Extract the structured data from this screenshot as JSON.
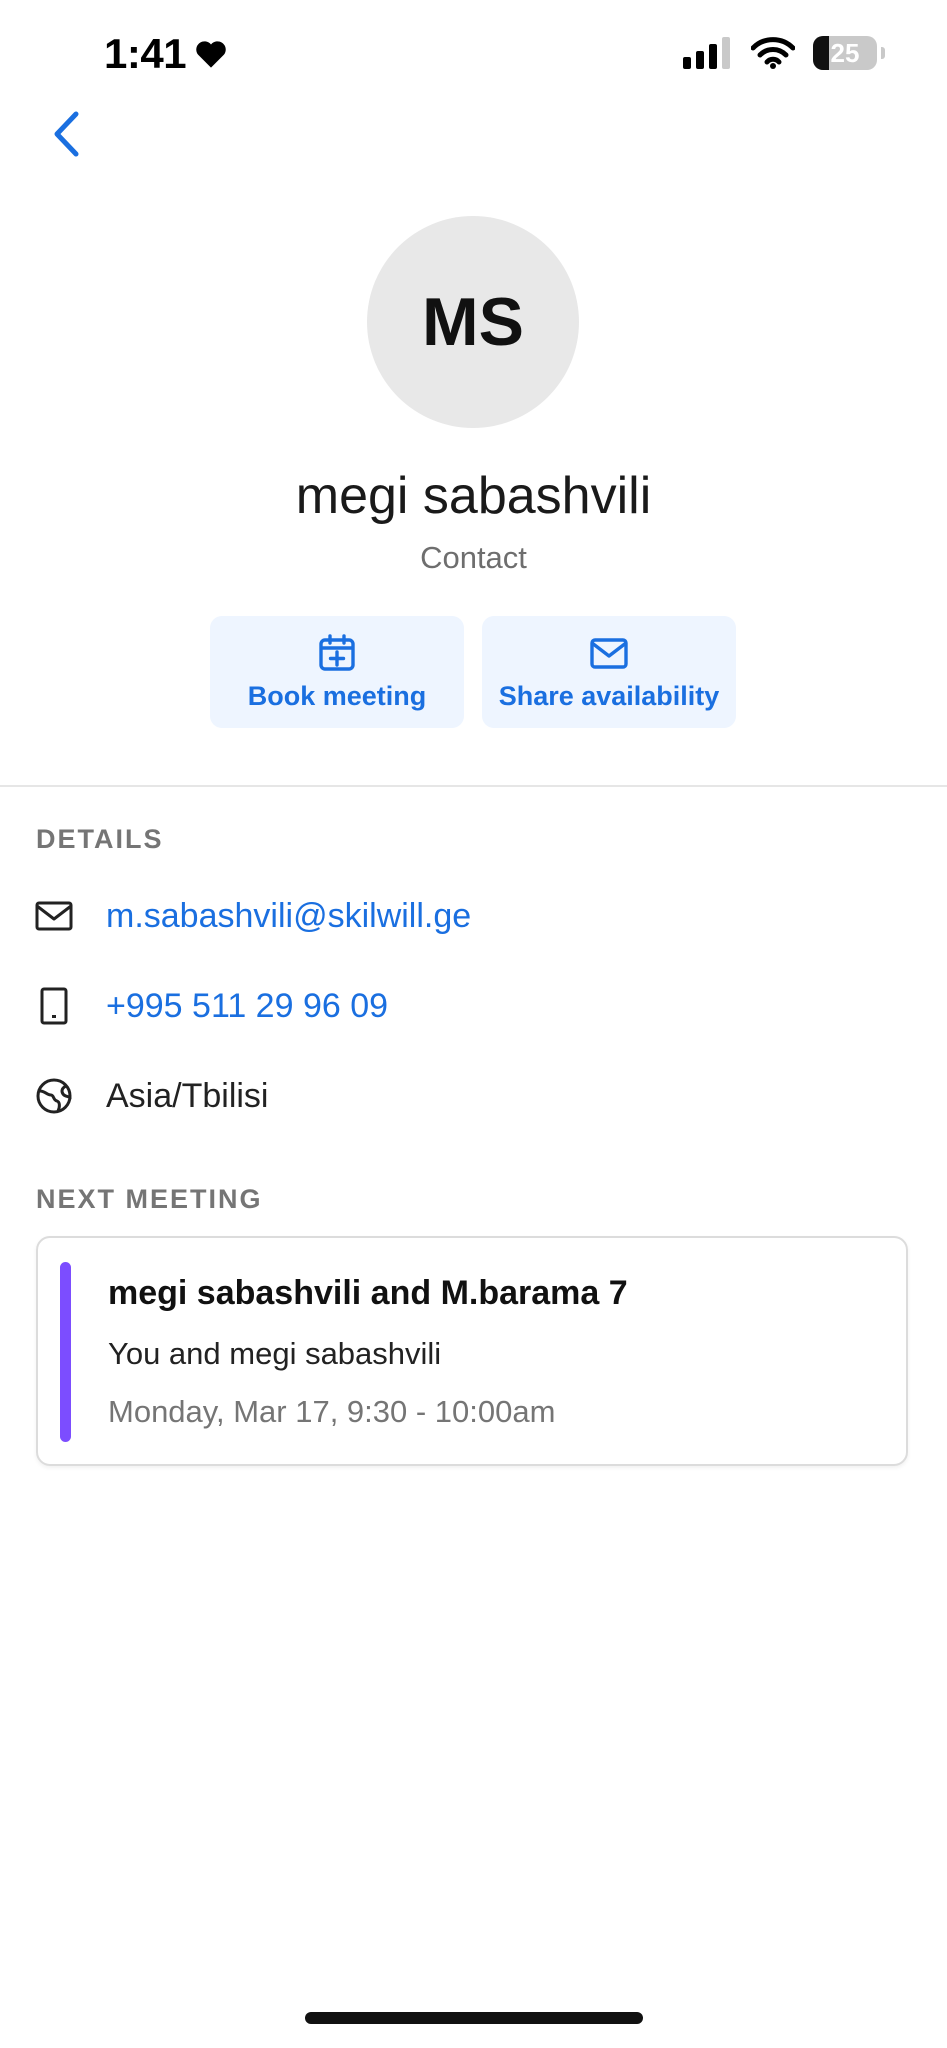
{
  "status_bar": {
    "time": "1:41",
    "battery": "25",
    "battery_fraction": 0.25
  },
  "header": {
    "back_icon": "chevron-left-icon"
  },
  "contact": {
    "initials": "MS",
    "name": "megi sabashvili",
    "type": "Contact"
  },
  "actions": {
    "book_label": "Book meeting",
    "share_label": "Share availability"
  },
  "details": {
    "section_label": "DETAILS",
    "email": "m.sabashvili@skilwill.ge",
    "phone": "+995 511 29 96 09",
    "timezone": "Asia/Tbilisi"
  },
  "next_meeting": {
    "section_label": "NEXT MEETING",
    "title": "megi sabashvili and M.barama 7",
    "attendees": "You and megi sabashvili",
    "time": "Monday, Mar 17, 9:30 - 10:00am",
    "accent_color": "#7c4dff"
  },
  "colors": {
    "link": "#1a6fe0",
    "action_bg": "#eef5ff"
  }
}
